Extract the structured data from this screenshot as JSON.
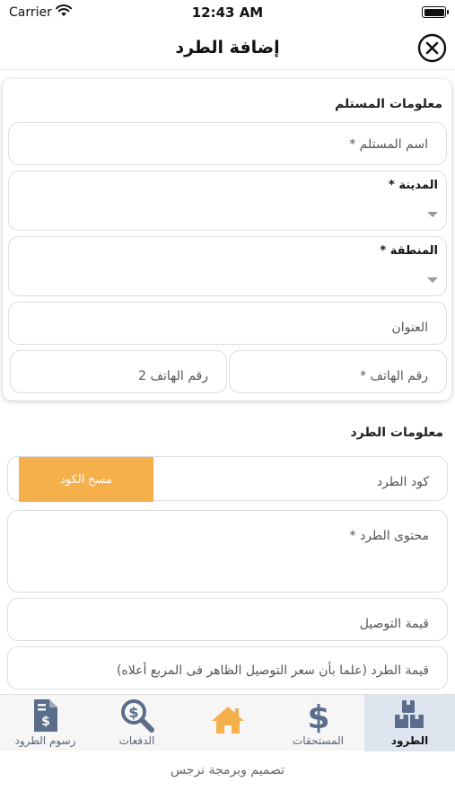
{
  "status_bar": {
    "carrier": "Carrier",
    "time": "12:43 AM"
  },
  "header": {
    "title": "إضافة الطرد",
    "close_icon": "close-circle-icon"
  },
  "recipient_section": {
    "title": "معلومات المستلم",
    "name_placeholder": "اسم المستلم *",
    "city_label": "المدينة *",
    "region_label": "المنطقة *",
    "address_placeholder": "العنوان",
    "phone_placeholder": "رقم الهاتف *",
    "phone2_placeholder": "رقم الهاتف 2"
  },
  "parcel_section": {
    "title": "معلومات الطرد",
    "code_placeholder": "كود الطرد",
    "scan_button": "مسح الكود",
    "content_placeholder": "محتوى الطرد *",
    "delivery_price_placeholder": "قيمة التوصيل",
    "value_placeholder": "قيمة الطرد (علما بأن سعر التوصيل الظاهر فى المربع أعلاه)"
  },
  "tabs": [
    {
      "label": "الطرود",
      "icon": "boxes-icon",
      "active": true
    },
    {
      "label": "المستحقات",
      "icon": "dollar-icon",
      "active": false
    },
    {
      "label": "",
      "icon": "home-icon",
      "active": false
    },
    {
      "label": "الدفعات",
      "icon": "search-dollar-icon",
      "active": false
    },
    {
      "label": "رسوم الطرود",
      "icon": "invoice-icon",
      "active": false
    }
  ],
  "colors": {
    "accent": "#F5B04C",
    "tab_icon": "#5A6E8C",
    "active_tab_bg": "#DFE5EF"
  },
  "footer": {
    "credit": "تصميم وبرمجة نرجس"
  }
}
